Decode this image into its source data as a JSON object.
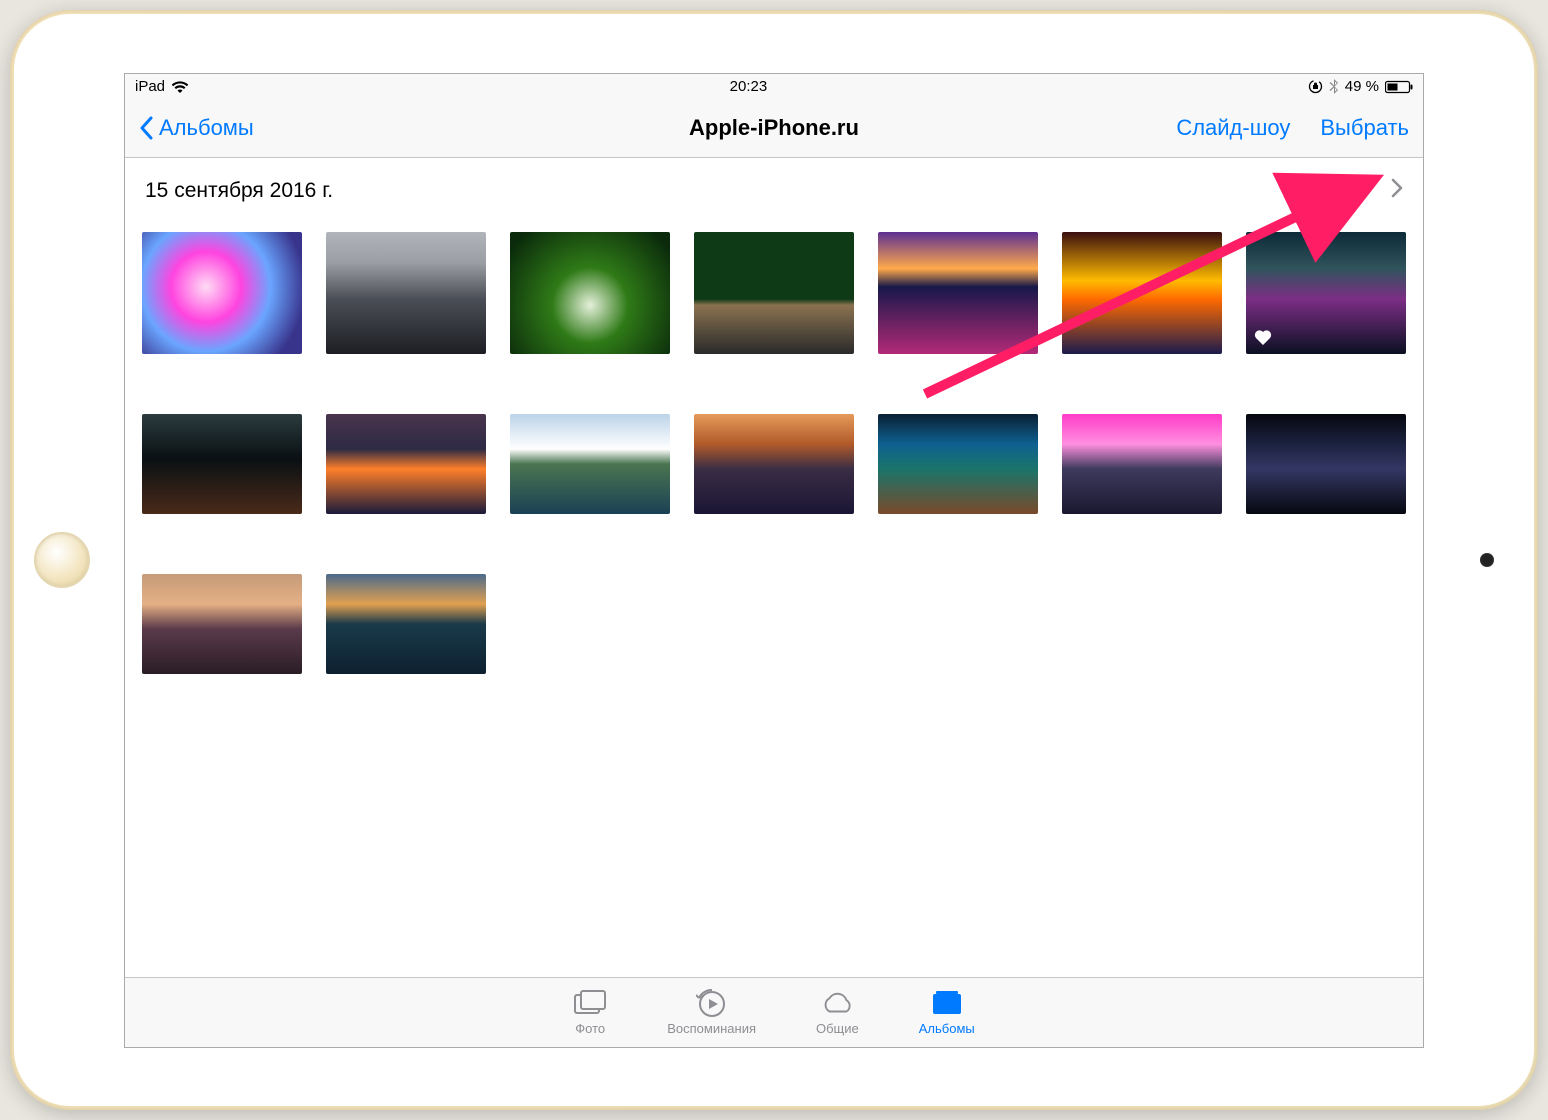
{
  "status": {
    "device": "iPad",
    "time": "20:23",
    "battery_text": "49 %"
  },
  "nav": {
    "back_label": "Альбомы",
    "title": "Apple-iPhone.ru",
    "slideshow_label": "Слайд-шоу",
    "select_label": "Выбрать"
  },
  "section": {
    "date_label": "15 сентября 2016 г."
  },
  "photos": [
    {
      "cls": "th1",
      "row": 1,
      "fav": false
    },
    {
      "cls": "th2",
      "row": 1,
      "fav": false
    },
    {
      "cls": "th3",
      "row": 1,
      "fav": false
    },
    {
      "cls": "th4",
      "row": 1,
      "fav": false
    },
    {
      "cls": "th5",
      "row": 1,
      "fav": false
    },
    {
      "cls": "th6",
      "row": 1,
      "fav": false
    },
    {
      "cls": "th7",
      "row": 1,
      "fav": true
    },
    {
      "cls": "th8",
      "row": 2,
      "fav": false
    },
    {
      "cls": "th9",
      "row": 2,
      "fav": false
    },
    {
      "cls": "th10",
      "row": 2,
      "fav": false
    },
    {
      "cls": "th11",
      "row": 2,
      "fav": false
    },
    {
      "cls": "th12",
      "row": 2,
      "fav": false
    },
    {
      "cls": "th13",
      "row": 2,
      "fav": false
    },
    {
      "cls": "th14",
      "row": 2,
      "fav": false
    },
    {
      "cls": "th15",
      "row": 3,
      "fav": false
    },
    {
      "cls": "th16",
      "row": 3,
      "fav": false
    }
  ],
  "tabs": {
    "photos": "Фото",
    "memories": "Воспоминания",
    "shared": "Общие",
    "albums": "Альбомы"
  },
  "colors": {
    "accent": "#007aff"
  }
}
